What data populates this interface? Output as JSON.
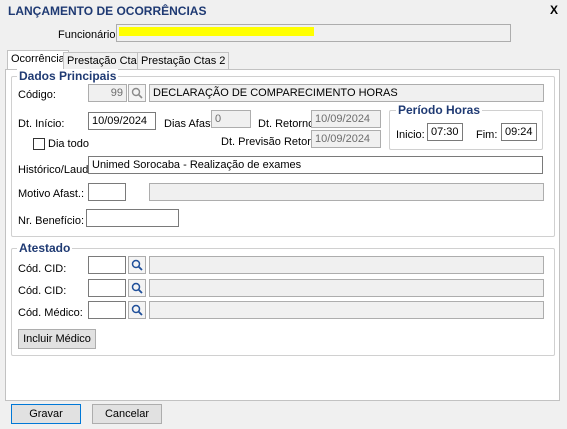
{
  "window": {
    "title": "LANÇAMENTO DE OCORRÊNCIAS",
    "close": "X"
  },
  "header": {
    "funcionario_label": "Funcionário:",
    "funcionario_value": ""
  },
  "tabs": [
    "Ocorrência",
    "Prestação Ctas",
    "Prestação Ctas 2"
  ],
  "dados": {
    "title": "Dados Principais",
    "codigo_label": "Código:",
    "codigo_value": "99",
    "codigo_desc": "DECLARAÇÃO DE COMPARECIMENTO HORAS",
    "dt_inicio_label": "Dt. Início:",
    "dt_inicio_value": "10/09/2024",
    "dias_afast_label": "Dias Afast.",
    "dias_afast_value": "0",
    "dt_retorno_label": "Dt. Retorno:",
    "dt_retorno_value": "10/09/2024",
    "dia_todo_label": "Dia todo",
    "dt_prev_label": "Dt. Previsão Retorno:",
    "dt_prev_value": "10/09/2024",
    "historico_label": "Histórico/Laudo:",
    "historico_value": "Unimed Sorocaba - Realização de exames",
    "motivo_label": "Motivo Afast.:",
    "beneficio_label": "Nr. Benefício:"
  },
  "periodo": {
    "title": "Período Horas",
    "inicio_label": "Inicio:",
    "inicio_value": "07:30",
    "fim_label": "Fim:",
    "fim_value": "09:24"
  },
  "atestado": {
    "title": "Atestado",
    "cid1_label": "Cód. CID:",
    "cid2_label": "Cód. CID:",
    "medico_label": "Cód. Médico:",
    "incluir_medico": "Incluir Médico"
  },
  "footer": {
    "gravar": "Gravar",
    "cancelar": "Cancelar"
  },
  "colors": {
    "title": "#1f3a73",
    "highlight": "#ffff00"
  }
}
